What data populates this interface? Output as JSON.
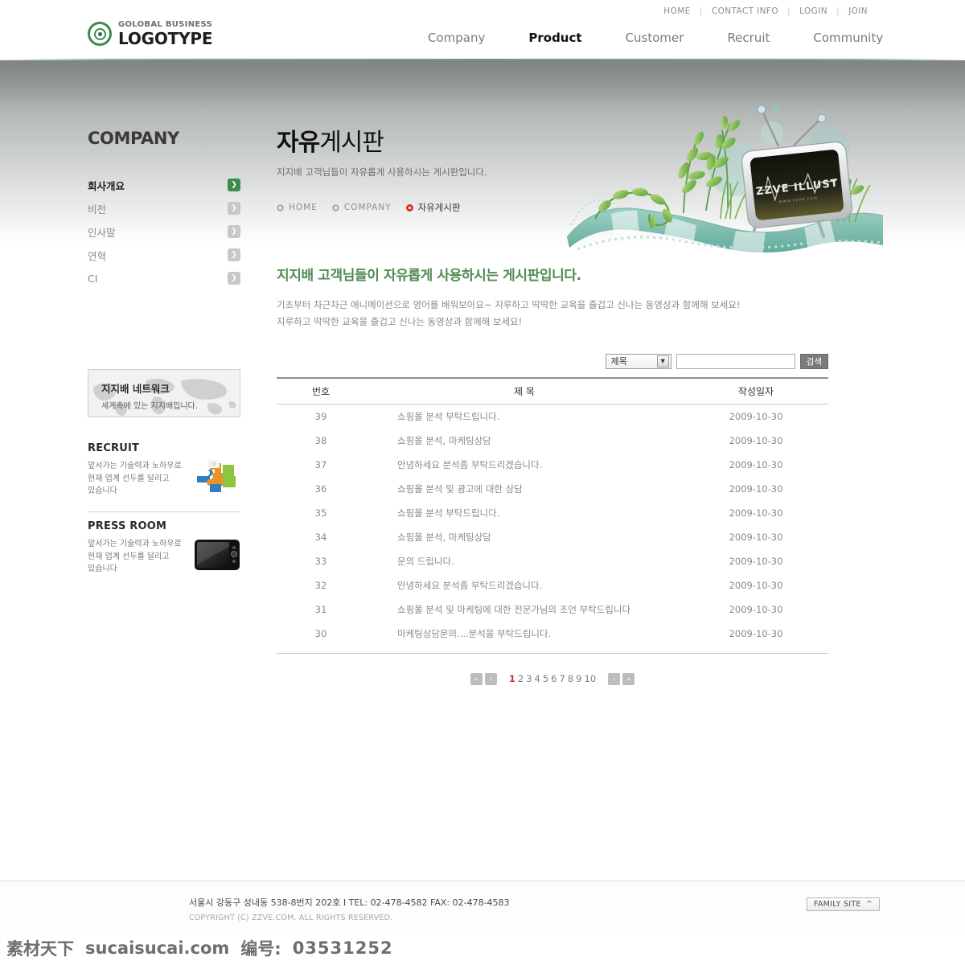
{
  "utility_nav": [
    {
      "label": "HOME"
    },
    {
      "label": "CONTACT INFO"
    },
    {
      "label": "LOGIN"
    },
    {
      "label": "JOIN"
    }
  ],
  "logo": {
    "top_text": "GOLOBAL BUSINESS",
    "main_text": "LOGOTYPE",
    "accent_color": "#3f8a4e"
  },
  "main_nav": [
    {
      "label": "Company",
      "active": false
    },
    {
      "label": "Product",
      "active": true
    },
    {
      "label": "Customer",
      "active": false
    },
    {
      "label": "Recruit",
      "active": false
    },
    {
      "label": "Community",
      "active": false
    }
  ],
  "sidebar": {
    "title": "COMPANY",
    "items": [
      {
        "label": "회사개요",
        "active": true
      },
      {
        "label": "비전",
        "active": false
      },
      {
        "label": "인사말",
        "active": false
      },
      {
        "label": "연혁",
        "active": false
      },
      {
        "label": "CI",
        "active": false
      }
    ],
    "network_banner": {
      "title": "지지배 네트워크",
      "subtitle": "세계속에 있는 지지배입니다."
    },
    "promos": [
      {
        "title": "RECRUIT",
        "line1": "앞서가는 기술력과 노하우로",
        "line2": "현재 업계 선두를 달리고",
        "line3": "있습니다",
        "icon": "puzzle-icon"
      },
      {
        "title": "PRESS ROOM",
        "line1": "앞서가는 기술력과 노하우로",
        "line2": "현재 업계 선두를 달리고",
        "line3": "있습니다",
        "icon": "monitor-icon"
      }
    ]
  },
  "hero": {
    "tv_screen_text": "ZZVE ILLUST",
    "tv_screen_sub": "www.zzve.com"
  },
  "page": {
    "title_bold": "자유",
    "title_rest": "게시판",
    "subtitle": "지지배 고객님들이 자유롭게 사용하시는 게시판입니다.",
    "breadcrumb": [
      {
        "label": "HOME",
        "current": false
      },
      {
        "label": "COMPANY",
        "current": false
      },
      {
        "label": "자유게시판",
        "current": true
      }
    ],
    "headline": "지지배 고객님들이 자유롭게 사용하시는 게시판입니다.",
    "lead_line1": "기초부터 차근차근 애니메이션으로 영어를 배워보아요~ 지루하고 딱딱한 교육을 즐겁고 신나는 동영상과 함께해 보세요!",
    "lead_line2": "지루하고 딱딱한 교육을 즐겁고 신나는 동영상과 함께해 보세요!",
    "headline_color": "#4f8a52"
  },
  "search": {
    "select_value": "제목",
    "input_value": "",
    "input_placeholder": "",
    "button_label": "검색"
  },
  "table": {
    "headers": [
      "번호",
      "제 목",
      "작성일자"
    ],
    "rows": [
      {
        "no": "39",
        "title": "쇼핑몰 분석 부탁드립니다.",
        "date": "2009-10-30"
      },
      {
        "no": "38",
        "title": "쇼핑몰 분석, 마케팅상담",
        "date": "2009-10-30"
      },
      {
        "no": "37",
        "title": "안녕하세요 분석좀 부탁드리겠습니다.",
        "date": "2009-10-30"
      },
      {
        "no": "36",
        "title": "쇼핑몰 분석 및 광고에 대한 상담",
        "date": "2009-10-30"
      },
      {
        "no": "35",
        "title": "쇼핑몰 분석 부탁드립니다.",
        "date": "2009-10-30"
      },
      {
        "no": "34",
        "title": "쇼핑몰 분석, 마케팅상담",
        "date": "2009-10-30"
      },
      {
        "no": "33",
        "title": "문의 드립니다.",
        "date": "2009-10-30"
      },
      {
        "no": "32",
        "title": "안녕하세요 분석좀 부탁드리겠습니다.",
        "date": "2009-10-30"
      },
      {
        "no": "31",
        "title": "쇼핑몰 분석 및 마케팅에 대한 전문가님의 조언 부탁드립니다",
        "date": "2009-10-30"
      },
      {
        "no": "30",
        "title": "마케팅상담문의....분석을 부탁드립니다.",
        "date": "2009-10-30"
      }
    ]
  },
  "pagination": {
    "first_label": "«",
    "prev_label": "‹",
    "next_label": "›",
    "last_label": "»",
    "pages": [
      "1",
      "2",
      "3",
      "4",
      "5",
      "6",
      "7",
      "8",
      "9",
      "10"
    ],
    "current_page": "1",
    "active_color": "#c4342a"
  },
  "footer": {
    "address": "서울시 강동구 성내동 538-8번지 202호 I  TEL: 02-478-4582  FAX: 02-478-4583",
    "copyright": "COPYRIGHT (C) ZZVE.COM. ALL RIGHTS RESERVED.",
    "family_site_label": "FAMILY SITE"
  },
  "watermark": {
    "site_cn": "素材天下",
    "site_en": "sucaisucai.com",
    "id_label": "编号:",
    "id_value": "03531252"
  }
}
